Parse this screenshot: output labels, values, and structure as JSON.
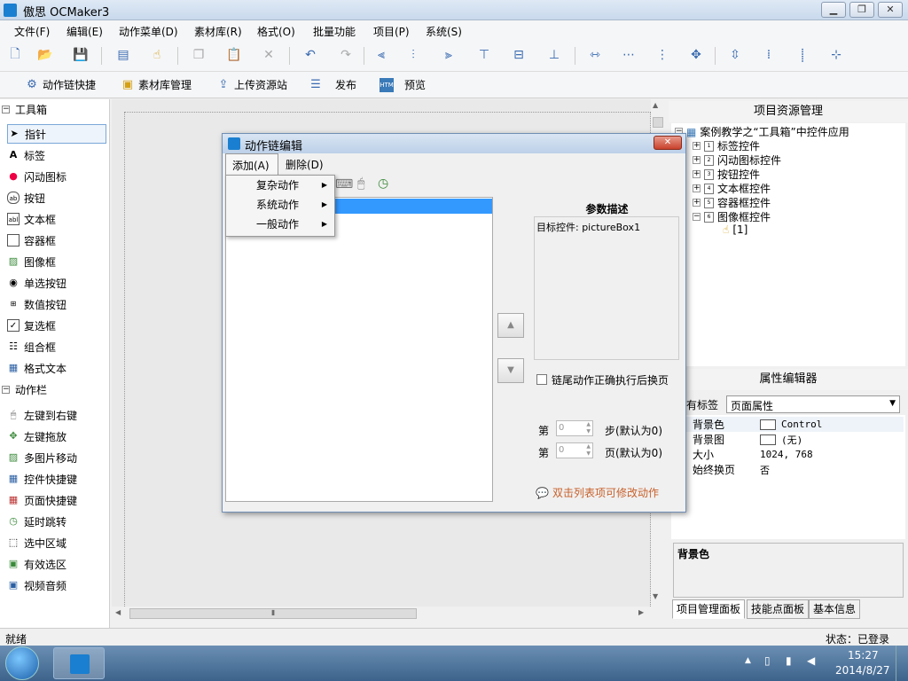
{
  "window": {
    "title": "傲思 OCMaker3"
  },
  "menubar": {
    "items": [
      "文件(F)",
      "编辑(E)",
      "动作菜单(D)",
      "素材库(R)",
      "格式(O)",
      "批量功能",
      "项目(P)",
      "系统(S)"
    ]
  },
  "toolbar2": {
    "items": [
      "动作链快捷",
      "素材库管理",
      "上传资源站",
      "发布",
      "预览"
    ]
  },
  "toolbox": {
    "header": "工具箱",
    "items": [
      "指针",
      "标签",
      "闪动图标",
      "按钮",
      "文本框",
      "容器框",
      "图像框",
      "单选按钮",
      "数值按钮",
      "复选框",
      "组合框",
      "格式文本"
    ],
    "action_header": "动作栏",
    "actions": [
      "左键到右键",
      "左键拖放",
      "多图片移动",
      "控件快捷键",
      "页面快捷键",
      "延时跳转",
      "选中区域",
      "有效选区",
      "视频音频"
    ]
  },
  "project": {
    "header": "项目资源管理",
    "root": "案例教学之“工具箱”中控件应用",
    "nodes": [
      "标签控件",
      "闪动图标控件",
      "按钮控件",
      "文本框控件",
      "容器框控件",
      "图像框控件"
    ],
    "child": "[1]"
  },
  "props": {
    "header": "属性编辑器",
    "tag_label": "有标签",
    "tag_value": "页面属性",
    "rows": [
      {
        "k": "背景色",
        "v": "Control"
      },
      {
        "k": "背景图",
        "v": "(无)"
      },
      {
        "k": "大小",
        "v": "1024, 768"
      },
      {
        "k": "始终换页",
        "v": "否"
      }
    ],
    "desc_title": "背景色"
  },
  "right_tabs": [
    "项目管理面板",
    "技能点面板",
    "基本信息"
  ],
  "dialog": {
    "title": "动作链编辑",
    "menu": [
      "添加(A)",
      "删除(D)"
    ],
    "dropdown": [
      "复杂动作",
      "系统动作",
      "一般动作"
    ],
    "param_title": "参数描述",
    "param_text": "目标控件: pictureBox1",
    "checkbox_label": "链尾动作正确执行后换页",
    "step_prefix": "第",
    "step_value": "0",
    "step_suffix": "步(默认为0)",
    "page_prefix": "第",
    "page_value": "0",
    "page_suffix": "页(默认为0)",
    "hint": "双击列表项可修改动作"
  },
  "status": {
    "left": "就绪",
    "right": "状态：已登录"
  },
  "taskbar": {
    "time": "15:27",
    "date": "2014/8/27"
  }
}
